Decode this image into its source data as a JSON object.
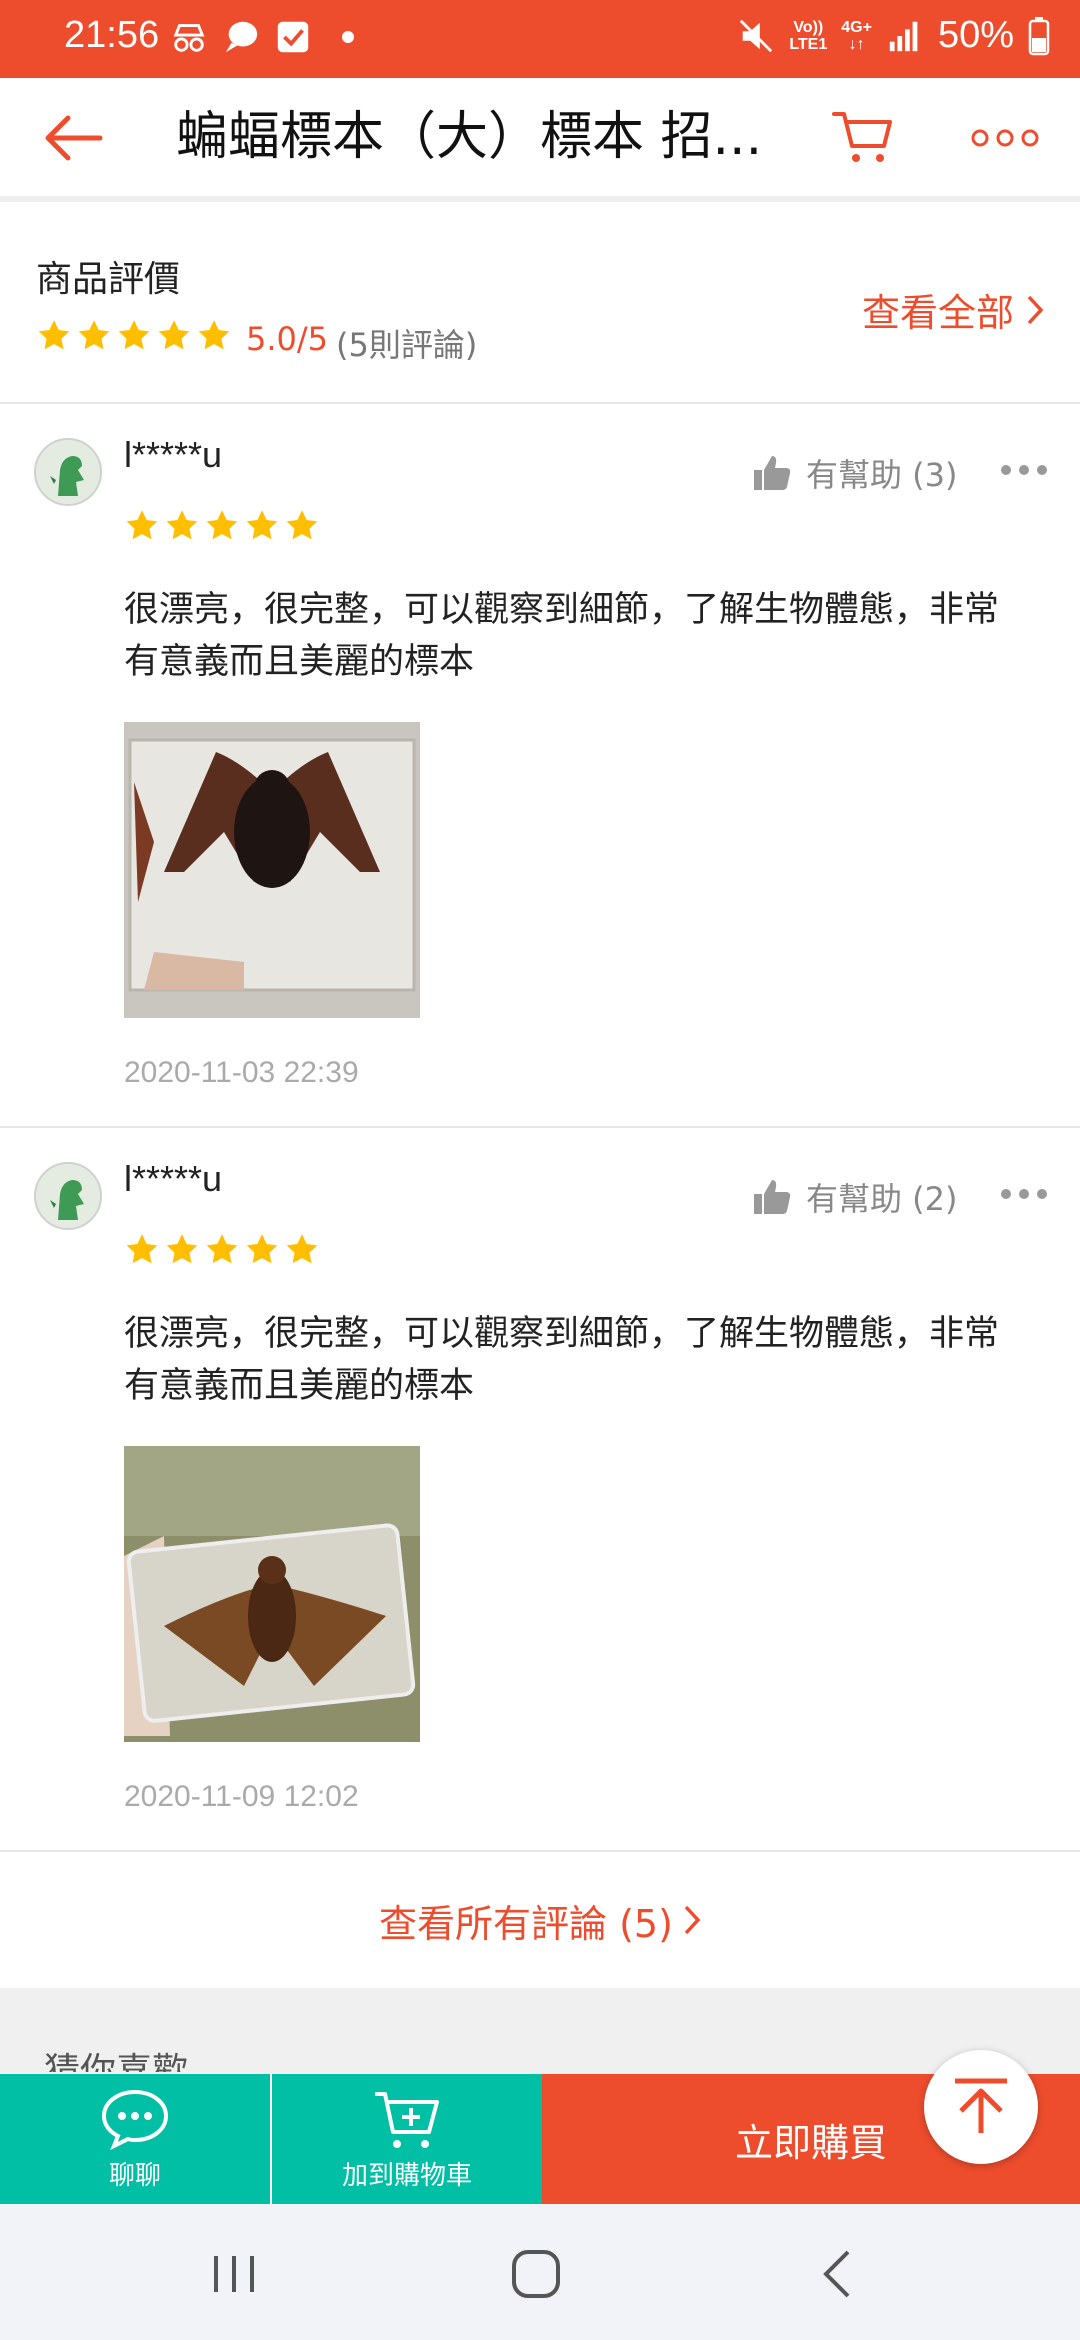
{
  "status_bar": {
    "time": "21:56",
    "volte_top": "Vo))",
    "volte_bottom": "LTE1",
    "network": "4G+",
    "battery": "50%",
    "icons": [
      "incognito-icon",
      "chat-bubble-icon",
      "checkbox-icon",
      "dot-icon",
      "mute-icon",
      "signal-icon",
      "battery-icon"
    ]
  },
  "header": {
    "title": "蝙蝠標本（大）標本 招...",
    "icons": [
      "back-arrow-icon",
      "cart-icon",
      "more-icon"
    ]
  },
  "summary": {
    "title": "商品評價",
    "stars": 5,
    "rating": "5.0/5",
    "count": "(5則評論)",
    "view_all": "查看全部"
  },
  "reviews": [
    {
      "user": "l*****u",
      "helpful": "有幫助 (3)",
      "stars": 5,
      "text": "很漂亮，很完整，可以觀察到細節，了解生物體態，非常有意義而且美麗的標本",
      "date": "2020-11-03 22:39"
    },
    {
      "user": "l*****u",
      "helpful": "有幫助 (2)",
      "stars": 5,
      "text": "很漂亮，很完整，可以觀察到細節，了解生物體態，非常有意義而且美麗的標本",
      "date": "2020-11-09 12:02"
    }
  ],
  "see_all_reviews": "查看所有評論 (5)",
  "guess_you_like": "猜你喜歡",
  "action_bar": {
    "chat": "聊聊",
    "add_to_cart": "加到購物車",
    "buy_now": "立即購買"
  },
  "colors": {
    "brand": "#ee4d2d",
    "chat_bar": "#00bfa5",
    "star": "#ffbf00"
  }
}
